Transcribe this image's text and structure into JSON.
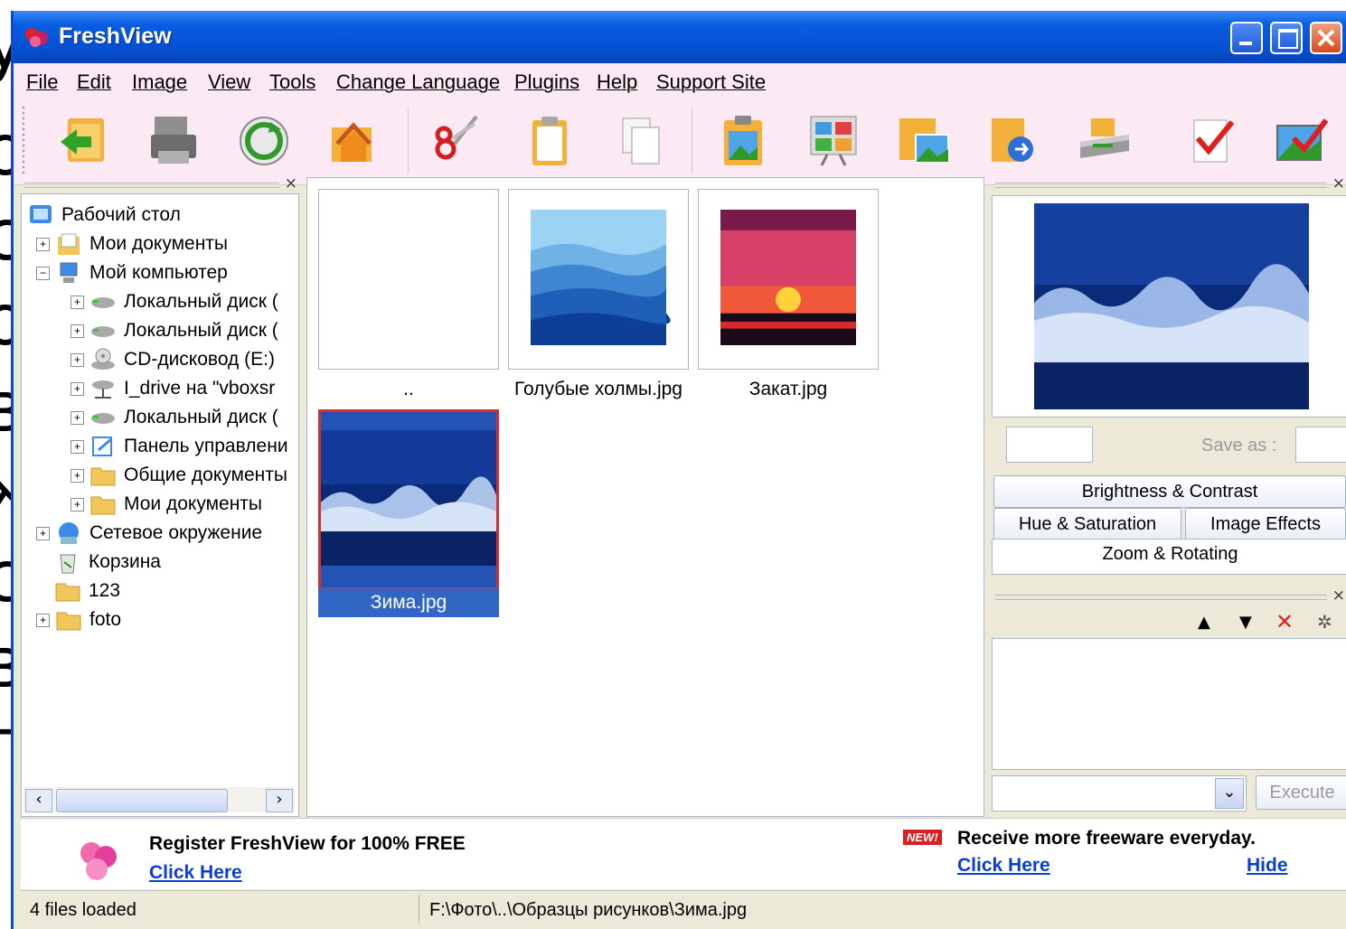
{
  "window": {
    "title": "FreshView"
  },
  "menu": [
    "File",
    "Edit",
    "Image",
    "View",
    "Tools",
    "Change Language",
    "Plugins",
    "Help",
    "Support Site"
  ],
  "toolbar": {
    "icons": [
      "folder-back-icon",
      "printer-icon",
      "refresh-icon",
      "home-folder-icon",
      "cut-icon",
      "paste-icon",
      "copy-icon",
      "clipboard-image-icon",
      "slideshow-icon",
      "image-folder-icon",
      "folder-move-icon",
      "scanner-icon",
      "checkmark-icon",
      "image-check-icon"
    ]
  },
  "tree": {
    "items": [
      {
        "label": "Рабочий стол",
        "icon": "desktop-icon"
      },
      {
        "label": "Мои документы",
        "icon": "documents-icon"
      },
      {
        "label": "Мой компьютер",
        "icon": "computer-icon"
      },
      {
        "label": "Локальный диск (",
        "icon": "drive-icon"
      },
      {
        "label": "Локальный диск (",
        "icon": "drive-icon"
      },
      {
        "label": "CD-дисковод (E:)",
        "icon": "cd-drive-icon"
      },
      {
        "label": "I_drive на \"vboxsr",
        "icon": "network-drive-icon"
      },
      {
        "label": "Локальный диск (",
        "icon": "drive-icon"
      },
      {
        "label": "Панель управлени",
        "icon": "control-panel-icon"
      },
      {
        "label": "Общие документы",
        "icon": "folder-icon"
      },
      {
        "label": "Мои документы",
        "icon": "folder-icon"
      },
      {
        "label": "Сетевое окружение",
        "icon": "network-icon"
      },
      {
        "label": "Корзина",
        "icon": "recycle-bin-icon"
      },
      {
        "label": "123",
        "icon": "folder-icon"
      },
      {
        "label": "foto",
        "icon": "folder-icon"
      }
    ]
  },
  "thumbnails": [
    {
      "label": "..",
      "selected": false
    },
    {
      "label": "Голубые холмы.jpg",
      "selected": false
    },
    {
      "label": "Закат.jpg",
      "selected": false
    },
    {
      "label": "Зима.jpg",
      "selected": true
    }
  ],
  "right_panel": {
    "save_as": "Save as :",
    "buttons": {
      "brightness": "Brightness & Contrast",
      "hue": "Hue & Saturation",
      "effects": "Image Effects",
      "zoom": "Zoom & Rotating",
      "execute": "Execute"
    }
  },
  "ad": {
    "register": "Register FreshView for 100% FREE",
    "click_here_left": "Click Here",
    "new_badge": "NEW!",
    "freeware": "Receive more freeware everyday.",
    "click_here_right": "Click Here",
    "hide": "Hide"
  },
  "status": {
    "files": "4 files loaded",
    "path": "F:\\Фото\\..\\Образцы рисунков\\Зима.jpg"
  },
  "background_letters": [
    "у",
    "о",
    "с",
    "о",
    "в",
    "ж",
    "с",
    "в",
    "п"
  ]
}
